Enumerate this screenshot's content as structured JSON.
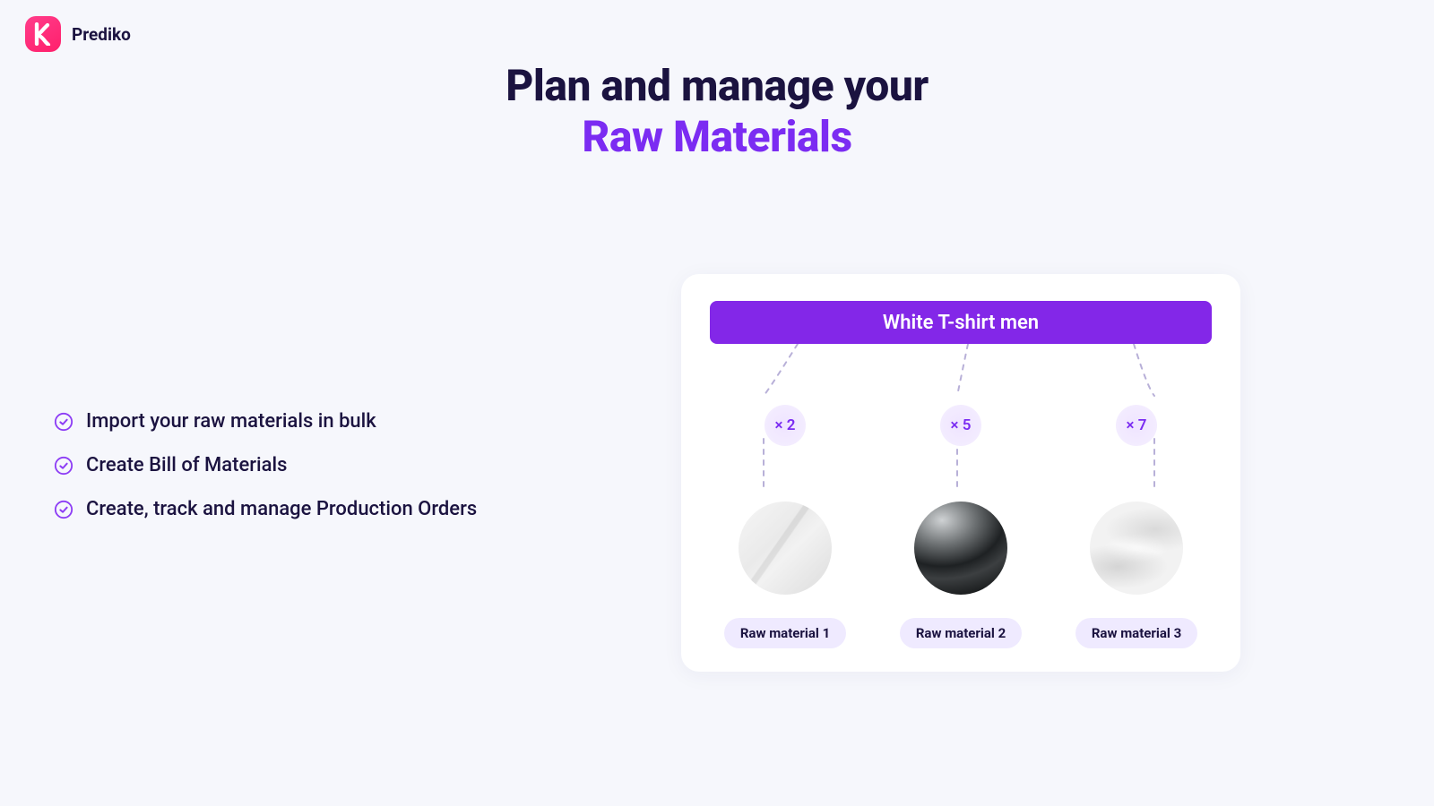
{
  "brand": {
    "name": "Prediko",
    "mark": "k"
  },
  "headline": {
    "line1": "Plan and manage your",
    "line2": "Raw Materials"
  },
  "colors": {
    "accent": "#7b2cf2",
    "brand_pink": "#ff2e79",
    "text": "#1b1340"
  },
  "bullets": [
    "Import your raw materials in bulk",
    "Create Bill of Materials",
    "Create, track and manage Production Orders"
  ],
  "card": {
    "product_name": "White T-shirt men",
    "materials": [
      {
        "qty_label": "× 2",
        "label": "Raw material 1"
      },
      {
        "qty_label": "× 5",
        "label": "Raw material 2"
      },
      {
        "qty_label": "× 7",
        "label": "Raw material 3"
      }
    ]
  }
}
